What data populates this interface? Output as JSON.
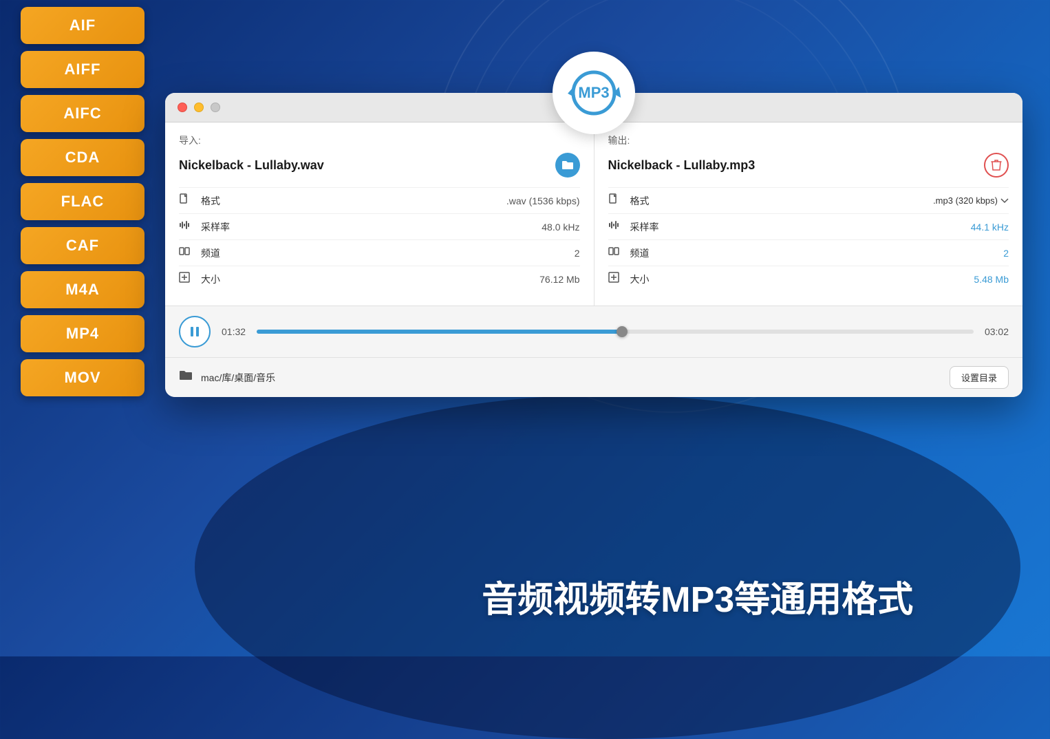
{
  "formats": [
    {
      "label": "AIF"
    },
    {
      "label": "AIFF"
    },
    {
      "label": "AIFC"
    },
    {
      "label": "CDA"
    },
    {
      "label": "FLAC"
    },
    {
      "label": "CAF"
    },
    {
      "label": "M4A"
    },
    {
      "label": "MP4"
    },
    {
      "label": "MOV"
    },
    {
      "label": "..."
    }
  ],
  "window": {
    "import_label": "导入:",
    "export_label": "输出:",
    "input_file": "Nickelback - Lullaby.wav",
    "output_file": "Nickelback - Lullaby.mp3",
    "input": {
      "format_label": "格式",
      "format_value": ".wav (1536 kbps)",
      "samplerate_label": "采样率",
      "samplerate_value": "48.0 kHz",
      "channel_label": "频道",
      "channel_value": "2",
      "size_label": "大小",
      "size_value": "76.12 Mb"
    },
    "output": {
      "format_label": "格式",
      "format_value": ".mp3 (320 kbps)",
      "samplerate_label": "采样率",
      "samplerate_value": "44.1 kHz",
      "channel_label": "频道",
      "channel_value": "2",
      "size_label": "大小",
      "size_value": "5.48 Mb"
    },
    "player": {
      "current_time": "01:32",
      "total_time": "03:02",
      "progress_percent": 51
    },
    "path": {
      "text": "mac/库/桌面/音乐",
      "set_dir_label": "设置目录"
    }
  },
  "convert_label": "MP3",
  "bottom_text": "音频视频转MP3等通用格式"
}
